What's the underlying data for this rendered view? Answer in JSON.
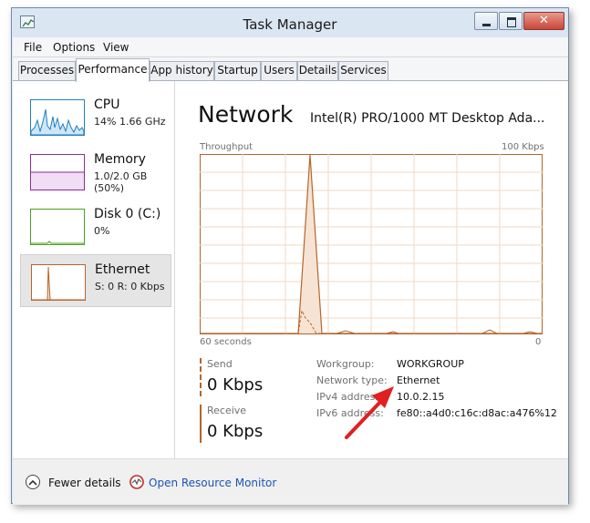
{
  "window": {
    "title": "Task Manager"
  },
  "menu": [
    "File",
    "Options",
    "View"
  ],
  "tabs": [
    "Processes",
    "Performance",
    "App history",
    "Startup",
    "Users",
    "Details",
    "Services"
  ],
  "active_tab": "Performance",
  "resources": [
    {
      "name": "CPU",
      "detail": "14%  1.66 GHz",
      "color": "#1f7fc0"
    },
    {
      "name": "Memory",
      "detail": "1.0/2.0 GB (50%)",
      "color": "#8b2a9c"
    },
    {
      "name": "Disk 0 (C:)",
      "detail": "0%",
      "color": "#4aa024"
    },
    {
      "name": "Ethernet",
      "detail": "S: 0  R: 0 Kbps",
      "color": "#b5652b",
      "selected": true
    }
  ],
  "main": {
    "heading": "Network",
    "adapter": "Intel(R) PRO/1000 MT Desktop Ada...",
    "graph": {
      "label_top_left": "Throughput",
      "label_top_right": "100 Kbps",
      "label_bottom_left": "60 seconds",
      "label_bottom_right": "0",
      "color": "#b5652b"
    },
    "send": {
      "label": "Send",
      "value": "0 Kbps"
    },
    "receive": {
      "label": "Receive",
      "value": "0 Kbps"
    },
    "properties": [
      {
        "label": "Workgroup:",
        "value": "WORKGROUP"
      },
      {
        "label": "Network type:",
        "value": "Ethernet"
      },
      {
        "label": "IPv4 address:",
        "value": "10.0.2.15"
      },
      {
        "label": "IPv6 address:",
        "value": "fe80::a4d0:c16c:d8ac:a476%12"
      }
    ]
  },
  "footer": {
    "fewer_details": "Fewer details",
    "resource_monitor": "Open Resource Monitor"
  },
  "annotation": {
    "color": "#e02020"
  }
}
